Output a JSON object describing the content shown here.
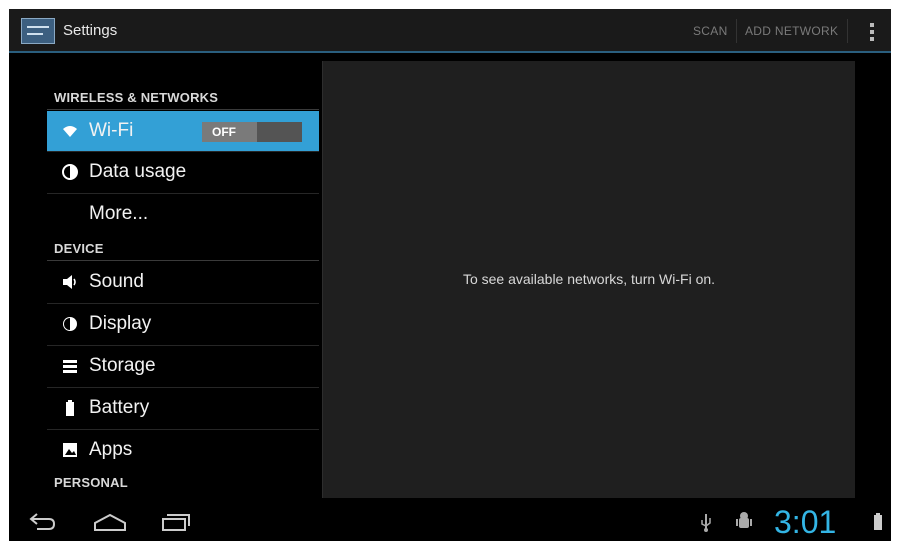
{
  "action_bar": {
    "title": "Settings",
    "actions": [
      "SCAN",
      "ADD NETWORK"
    ]
  },
  "left_pane": {
    "categories": {
      "wireless": "WIRELESS & NETWORKS",
      "device": "DEVICE",
      "personal": "PERSONAL"
    },
    "items": [
      {
        "label": "Wi-Fi",
        "icon": "wifi-icon",
        "selected": true
      },
      {
        "label": "Data usage",
        "icon": "data-usage-icon"
      },
      {
        "label": "More...",
        "icon": ""
      },
      {
        "label": "Sound",
        "icon": "sound-icon"
      },
      {
        "label": "Display",
        "icon": "display-icon"
      },
      {
        "label": "Storage",
        "icon": "storage-icon"
      },
      {
        "label": "Battery",
        "icon": "battery-icon"
      },
      {
        "label": "Apps",
        "icon": "apps-icon"
      }
    ],
    "wifi_toggle": "OFF"
  },
  "detail": {
    "message": "To see available networks, turn Wi-Fi on."
  },
  "system_bar": {
    "time": "3:01",
    "icons": [
      "back-icon",
      "home-icon",
      "recent-apps-icon",
      "usb-icon",
      "android-debug-icon",
      "battery-status-icon"
    ]
  },
  "colors": {
    "accent": "#33a0d6",
    "clock": "#33b5e5"
  }
}
